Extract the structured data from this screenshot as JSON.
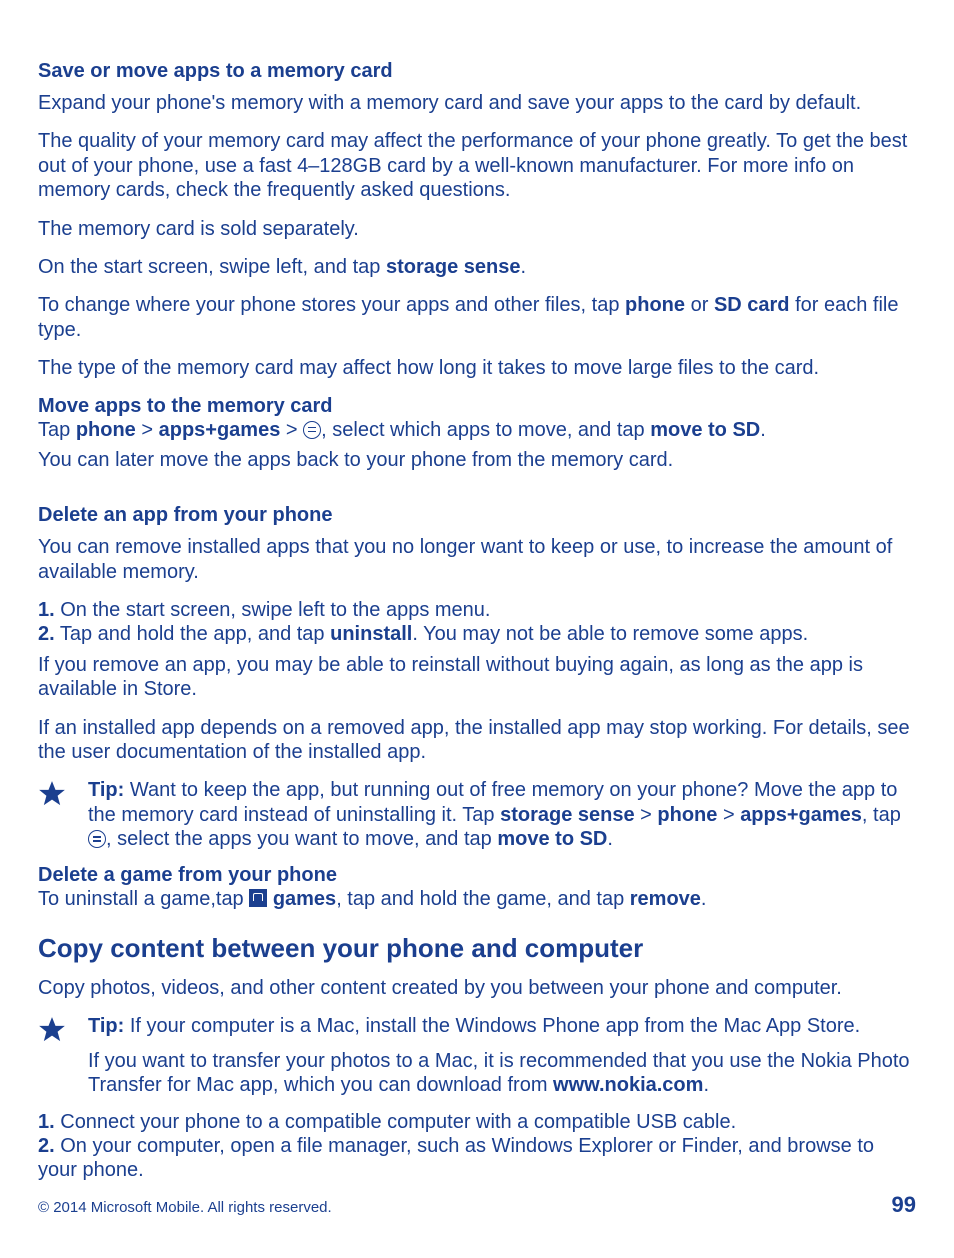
{
  "sec1": {
    "heading": "Save or move apps to a memory card",
    "p1": "Expand your phone's memory with a memory card and save your apps to the card by default.",
    "p2": "The quality of your memory card may affect the performance of your phone greatly. To get the best out of your phone, use a fast 4–128GB card by a well-known manufacturer. For more info on memory cards, check the frequently asked questions.",
    "p3": "The memory card is sold separately.",
    "p4_a": "On the start screen, swipe left, and tap ",
    "p4_b": "storage sense",
    "p4_c": ".",
    "p5_a": "To change where your phone stores your apps and other files, tap ",
    "p5_b": "phone",
    "p5_c": " or ",
    "p5_d": "SD card",
    "p5_e": " for each file type.",
    "p6": "The type of the memory card may affect how long it takes to move large files to the card."
  },
  "sec2": {
    "heading": "Move apps to the memory card",
    "line_a": "Tap ",
    "line_b": "phone",
    "line_c": " > ",
    "line_d": "apps+games",
    "line_e": " > ",
    "line_f": ", select which apps to move, and tap ",
    "line_g": "move to SD",
    "line_h": ".",
    "p2": "You can later move the apps back to your phone from the memory card."
  },
  "sec3": {
    "heading": "Delete an app from your phone",
    "p1": "You can remove installed apps that you no longer want to keep or use, to increase the amount of available memory.",
    "ol1_num": "1.",
    "ol1_text": " On the start screen, swipe left to the apps menu.",
    "ol2_num": "2.",
    "ol2_a": " Tap and hold the app, and tap ",
    "ol2_b": "uninstall",
    "ol2_c": ". You may not be able to remove some apps.",
    "p2": "If you remove an app, you may be able to reinstall without buying again, as long as the app is available in Store.",
    "p3": "If an installed app depends on a removed app, the installed app may stop working. For details, see the user documentation of the installed app.",
    "tip_label": "Tip:",
    "tip_a": " Want to keep the app, but running out of free memory on your phone? Move the app to the memory card instead of uninstalling it. Tap ",
    "tip_b": "storage sense",
    "tip_c": " > ",
    "tip_d": "phone",
    "tip_e": " > ",
    "tip_f": "apps+games",
    "tip_g": ", tap ",
    "tip_h": ", select the apps you want to move, and tap ",
    "tip_i": "move to SD",
    "tip_j": "."
  },
  "sec4": {
    "heading": "Delete a game from your phone",
    "a": "To uninstall a game,tap ",
    "b": "games",
    "c": ", tap and hold the game, and tap ",
    "d": "remove",
    "e": "."
  },
  "sec5": {
    "heading": "Copy content between your phone and computer",
    "p1": "Copy photos, videos, and other content created by you between your phone and computer.",
    "tip_label": "Tip:",
    "tip_a": " If your computer is a Mac, install the Windows Phone app from the Mac App Store.",
    "tip_b1": "If you want to transfer your photos to a Mac, it is recommended that you use the Nokia Photo Transfer for Mac app, which you can download from ",
    "tip_b2": "www.nokia.com",
    "tip_b3": ".",
    "ol1_num": "1.",
    "ol1_text": " Connect your phone to a compatible computer with a compatible USB cable.",
    "ol2_num": "2.",
    "ol2_text": " On your computer, open a file manager, such as Windows Explorer or Finder, and browse to your phone."
  },
  "footer": {
    "copyright": "© 2014 Microsoft Mobile. All rights reserved.",
    "page": "99"
  }
}
